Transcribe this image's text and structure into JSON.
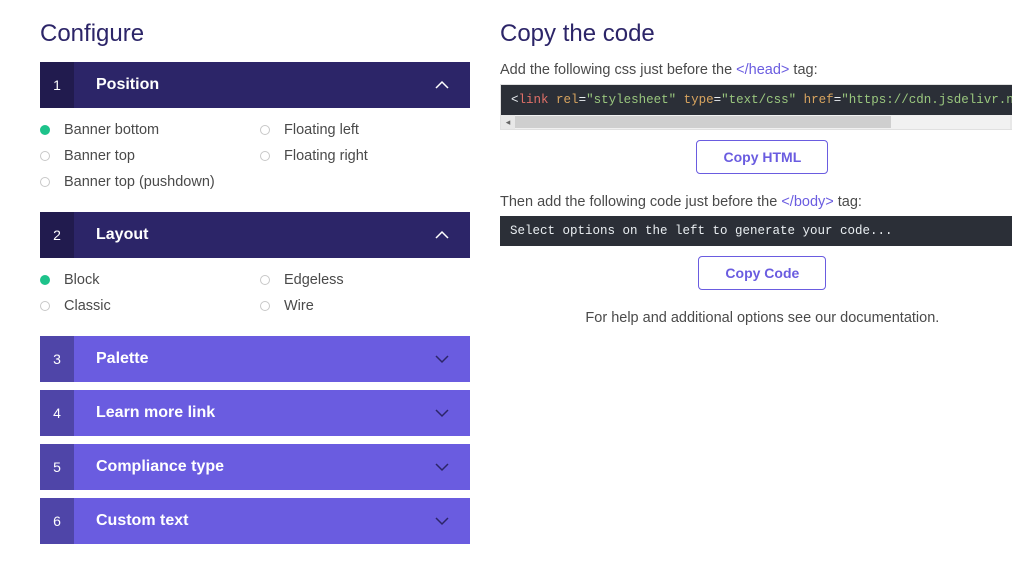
{
  "left": {
    "heading": "Configure",
    "sections": [
      {
        "num": "1",
        "title": "Position",
        "expanded": true,
        "options": [
          {
            "label": "Banner bottom",
            "selected": true
          },
          {
            "label": "Floating left",
            "selected": false
          },
          {
            "label": "Banner top",
            "selected": false
          },
          {
            "label": "Floating right",
            "selected": false
          },
          {
            "label": "Banner top (pushdown)",
            "selected": false
          }
        ]
      },
      {
        "num": "2",
        "title": "Layout",
        "expanded": true,
        "options": [
          {
            "label": "Block",
            "selected": true
          },
          {
            "label": "Edgeless",
            "selected": false
          },
          {
            "label": "Classic",
            "selected": false
          },
          {
            "label": "Wire",
            "selected": false
          }
        ]
      },
      {
        "num": "3",
        "title": "Palette",
        "expanded": false
      },
      {
        "num": "4",
        "title": "Learn more link",
        "expanded": false
      },
      {
        "num": "5",
        "title": "Compliance type",
        "expanded": false
      },
      {
        "num": "6",
        "title": "Custom text",
        "expanded": false
      }
    ]
  },
  "right": {
    "heading": "Copy the code",
    "step1_pre": "Add the following css just before the ",
    "step1_tag": "</head>",
    "step1_post": " tag:",
    "code1": {
      "tag_open": "<",
      "tag_name": "link",
      "attr1_name": "rel",
      "attr1_eq": "=",
      "attr1_val": "\"stylesheet\"",
      "attr2_name": "type",
      "attr2_eq": "=",
      "attr2_val": "\"text/css\"",
      "attr3_name": "href",
      "attr3_eq": "=",
      "attr3_val": "\"https://cdn.jsdelivr.n"
    },
    "btn1": "Copy HTML",
    "step2_pre": "Then add the following code just before the ",
    "step2_tag": "</body>",
    "step2_post": " tag:",
    "code2": "Select options on the left to generate your code...",
    "btn2": "Copy Code",
    "help": "For help and additional options see our documentation."
  }
}
